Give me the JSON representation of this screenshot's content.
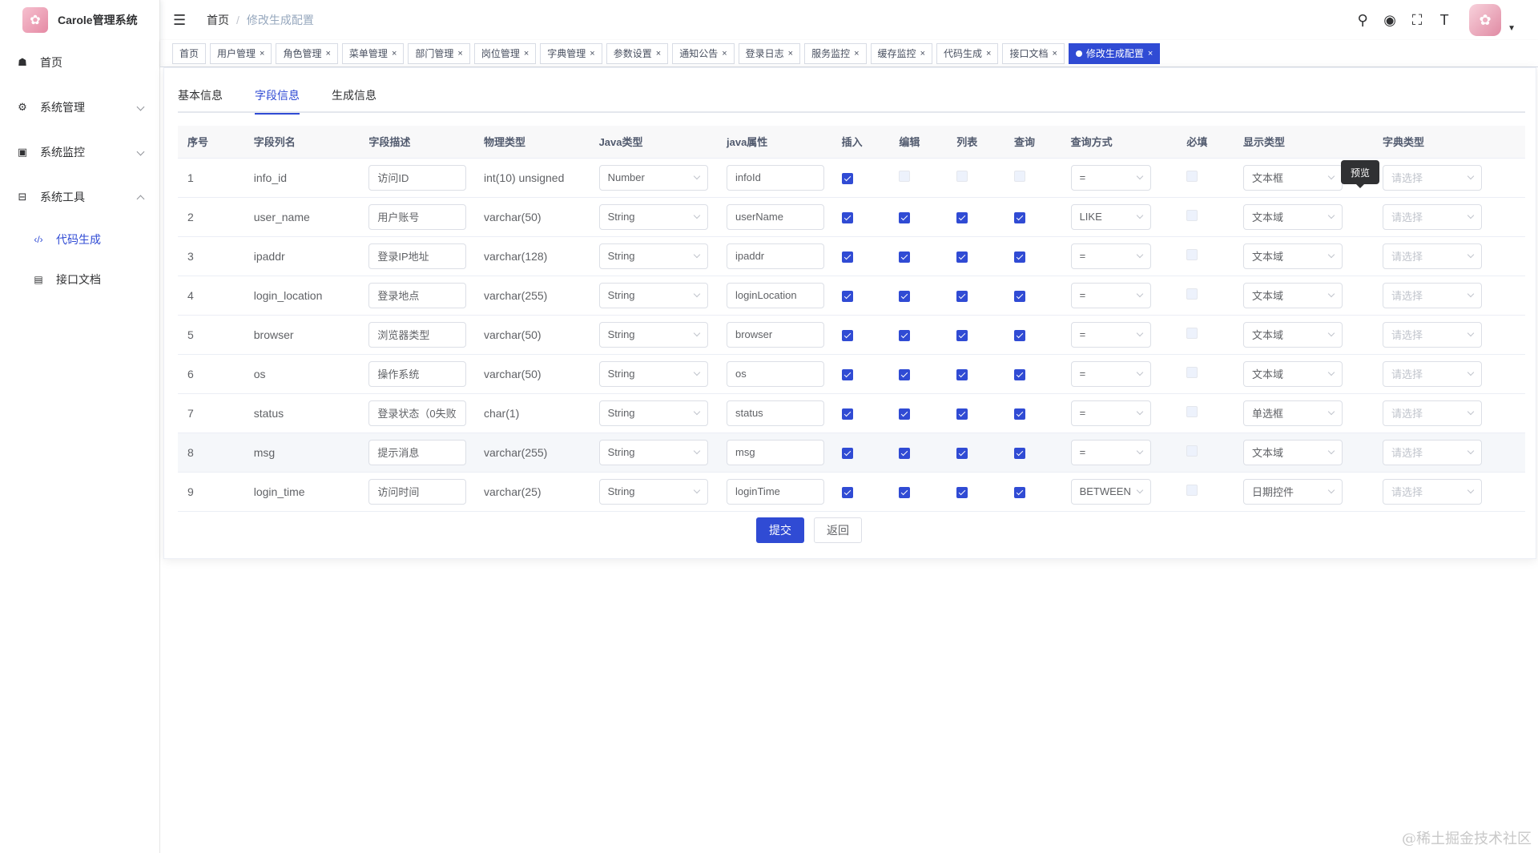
{
  "app": {
    "title": "Carole管理系统"
  },
  "sidebar": {
    "items": [
      {
        "label": "首页",
        "icon": "dashboard-icon",
        "glyph": "☗"
      },
      {
        "label": "系统管理",
        "icon": "gear-icon",
        "glyph": "⚙"
      },
      {
        "label": "系统监控",
        "icon": "monitor-icon",
        "glyph": "▣"
      },
      {
        "label": "系统工具",
        "icon": "toolbox-icon",
        "glyph": "⊟"
      }
    ],
    "subitems": [
      {
        "label": "代码生成",
        "icon": "code-icon",
        "glyph": "‹/›"
      },
      {
        "label": "接口文档",
        "icon": "document-icon",
        "glyph": "▤"
      }
    ]
  },
  "breadcrumb": {
    "home": "首页",
    "current": "修改生成配置"
  },
  "tags": [
    "首页",
    "用户管理",
    "角色管理",
    "菜单管理",
    "部门管理",
    "岗位管理",
    "字典管理",
    "参数设置",
    "通知公告",
    "登录日志",
    "服务监控",
    "缓存监控",
    "代码生成",
    "接口文档",
    "修改生成配置"
  ],
  "tabs": [
    "基本信息",
    "字段信息",
    "生成信息"
  ],
  "table": {
    "headers": [
      "序号",
      "字段列名",
      "字段描述",
      "物理类型",
      "Java类型",
      "java属性",
      "插入",
      "编辑",
      "列表",
      "查询",
      "查询方式",
      "必填",
      "显示类型",
      "字典类型"
    ],
    "dict_placeholder": "请选择",
    "rows": [
      {
        "no": "1",
        "column": "info_id",
        "desc": "访问ID",
        "phys": "int(10) unsigned",
        "jtype": "Number",
        "jattr": "infoId",
        "insert": true,
        "edit": false,
        "list": false,
        "query": false,
        "qmode": "=",
        "required": false,
        "display": "文本框"
      },
      {
        "no": "2",
        "column": "user_name",
        "desc": "用户账号",
        "phys": "varchar(50)",
        "jtype": "String",
        "jattr": "userName",
        "insert": true,
        "edit": true,
        "list": true,
        "query": true,
        "qmode": "LIKE",
        "required": false,
        "display": "文本域"
      },
      {
        "no": "3",
        "column": "ipaddr",
        "desc": "登录IP地址",
        "phys": "varchar(128)",
        "jtype": "String",
        "jattr": "ipaddr",
        "insert": true,
        "edit": true,
        "list": true,
        "query": true,
        "qmode": "=",
        "required": false,
        "display": "文本域"
      },
      {
        "no": "4",
        "column": "login_location",
        "desc": "登录地点",
        "phys": "varchar(255)",
        "jtype": "String",
        "jattr": "loginLocation",
        "insert": true,
        "edit": true,
        "list": true,
        "query": true,
        "qmode": "=",
        "required": false,
        "display": "文本域"
      },
      {
        "no": "5",
        "column": "browser",
        "desc": "浏览器类型",
        "phys": "varchar(50)",
        "jtype": "String",
        "jattr": "browser",
        "insert": true,
        "edit": true,
        "list": true,
        "query": true,
        "qmode": "=",
        "required": false,
        "display": "文本域"
      },
      {
        "no": "6",
        "column": "os",
        "desc": "操作系统",
        "phys": "varchar(50)",
        "jtype": "String",
        "jattr": "os",
        "insert": true,
        "edit": true,
        "list": true,
        "query": true,
        "qmode": "=",
        "required": false,
        "display": "文本域"
      },
      {
        "no": "7",
        "column": "status",
        "desc": "登录状态（0失败",
        "phys": "char(1)",
        "jtype": "String",
        "jattr": "status",
        "insert": true,
        "edit": true,
        "list": true,
        "query": true,
        "qmode": "=",
        "required": false,
        "display": "单选框"
      },
      {
        "no": "8",
        "column": "msg",
        "desc": "提示消息",
        "phys": "varchar(255)",
        "jtype": "String",
        "jattr": "msg",
        "insert": true,
        "edit": true,
        "list": true,
        "query": true,
        "qmode": "=",
        "required": false,
        "display": "文本域"
      },
      {
        "no": "9",
        "column": "login_time",
        "desc": "访问时间",
        "phys": "varchar(25)",
        "jtype": "String",
        "jattr": "loginTime",
        "insert": true,
        "edit": true,
        "list": true,
        "query": true,
        "qmode": "BETWEEN",
        "required": false,
        "display": "日期控件"
      }
    ]
  },
  "tooltip": "预览",
  "buttons": {
    "submit": "提交",
    "back": "返回"
  },
  "watermark": "@稀土掘金技术社区",
  "colors": {
    "primary": "#304bd4",
    "text": "#606266"
  }
}
